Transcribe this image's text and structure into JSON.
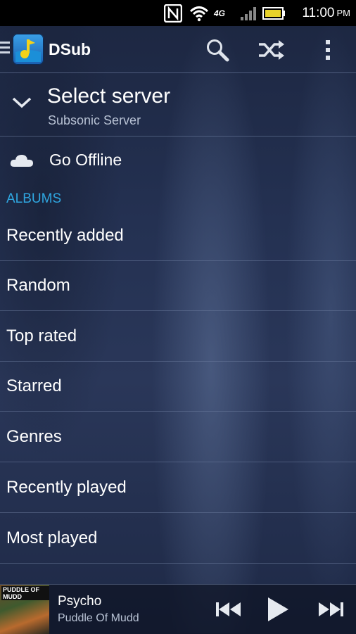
{
  "status_bar": {
    "icons": [
      "nfc-icon",
      "wifi-icon",
      "4g-icon",
      "signal-icon",
      "battery-icon"
    ],
    "network_label": "4G",
    "time": "11:00",
    "ampm": "PM"
  },
  "action_bar": {
    "app_title": "DSub",
    "icons": [
      "menu-icon",
      "app-logo-icon",
      "search-icon",
      "shuffle-icon",
      "overflow-icon"
    ]
  },
  "server": {
    "title": "Select server",
    "subtitle": "Subsonic Server"
  },
  "offline": {
    "label": "Go Offline"
  },
  "albums": {
    "section_label": "ALBUMS",
    "items": [
      {
        "label": "Recently added"
      },
      {
        "label": "Random"
      },
      {
        "label": "Top rated"
      },
      {
        "label": "Starred"
      },
      {
        "label": "Genres"
      },
      {
        "label": "Recently played"
      },
      {
        "label": "Most played"
      }
    ]
  },
  "now_playing": {
    "cover_text": "PUDDLE OF MUDD",
    "title": "Psycho",
    "artist": "Puddle Of Mudd",
    "controls": [
      "previous-icon",
      "play-icon",
      "next-icon"
    ]
  },
  "colors": {
    "accent": "#2fa6e0",
    "status_bar_bg": "#000000",
    "background": "#243152"
  }
}
